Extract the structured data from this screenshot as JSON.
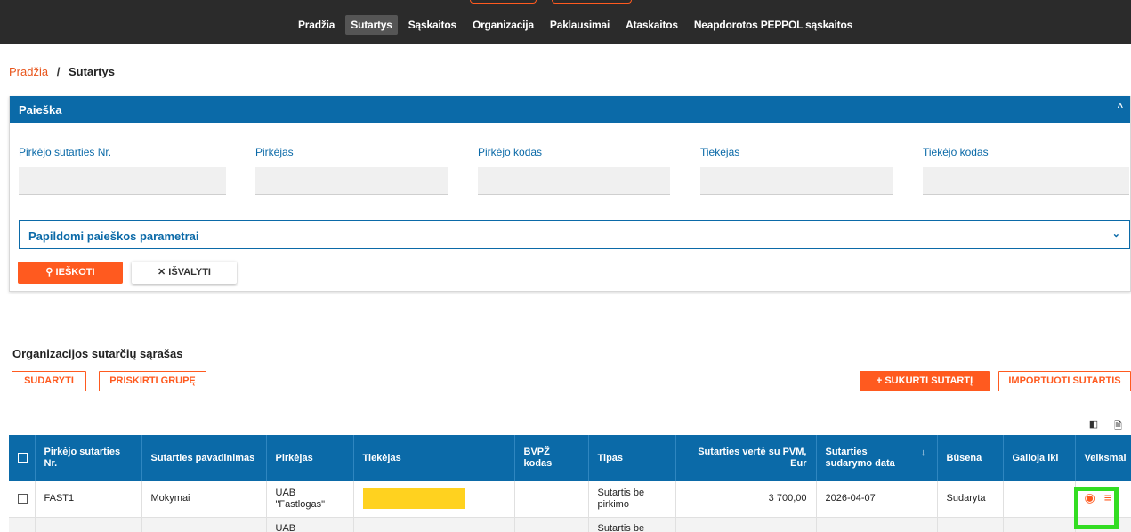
{
  "topnav": {
    "items": [
      {
        "label": "Pradžia",
        "active": false
      },
      {
        "label": "Sutartys",
        "active": true
      },
      {
        "label": "Sąskaitos",
        "active": false
      },
      {
        "label": "Organizacija",
        "active": false
      },
      {
        "label": "Paklausimai",
        "active": false
      },
      {
        "label": "Ataskaitos",
        "active": false
      },
      {
        "label": "Neapdorotos PEPPOL sąskaitos",
        "active": false
      }
    ]
  },
  "breadcrumb": {
    "home": "Pradžia",
    "separator": "/",
    "current": "Sutartys"
  },
  "search": {
    "title": "Paieška",
    "fields": [
      {
        "label": "Pirkėjo sutarties Nr.",
        "value": ""
      },
      {
        "label": "Pirkėjas",
        "value": ""
      },
      {
        "label": "Pirkėjo kodas",
        "value": ""
      },
      {
        "label": "Tiekėjas",
        "value": ""
      },
      {
        "label": "Tiekėjo kodas",
        "value": ""
      }
    ],
    "extra_params": "Papildomi paieškos parametrai",
    "search_button": "IEŠKOTI",
    "clear_button": "IŠVALYTI"
  },
  "list": {
    "title": "Organizacijos sutarčių sąrašas",
    "buttons": {
      "sudaryti": "SUDARYTI",
      "priskirti": "PRISKIRTI GRUPĘ",
      "sukurti": "SUKURTI SUTARTĮ",
      "importuoti": "IMPORTUOTI SUTARTIS"
    },
    "columns": [
      "Pirkėjo sutarties Nr.",
      "Sutarties pavadinimas",
      "Pirkėjas",
      "Tiekėjas",
      "BVPŽ kodas",
      "Tipas",
      "Sutarties vertė su PVM, Eur",
      "Sutarties sudarymo data",
      "Būsena",
      "Galioja iki",
      "Veiksmai"
    ],
    "sort_indicator": "↓",
    "rows": [
      {
        "nr": "FAST1",
        "name": "Mokymai",
        "buyer": "UAB \"Fastlogas\"",
        "supplier": "",
        "bvpz": "",
        "type": "Sutartis be pirkimo",
        "value": "3 700,00",
        "date": "2026-04-07",
        "status": "Sudaryta",
        "valid_until": ""
      },
      {
        "nr": "",
        "name": "",
        "buyer": "UAB",
        "supplier": "",
        "bvpz": "",
        "type": "Sutartis be",
        "value": "",
        "date": "",
        "status": "",
        "valid_until": ""
      }
    ]
  },
  "colors": {
    "nav_bg": "#2b2b2b",
    "primary_blue": "#0b6aa8",
    "accent_orange": "#ff5a1f",
    "highlight_yellow": "#ffd21f",
    "annotation_green": "#33dd22"
  },
  "icons": {
    "search": "search-icon",
    "clear": "close-icon",
    "add": "plus-icon",
    "view": "eye-icon",
    "row_menu": "menu-icon",
    "collapse": "chevron-up-icon",
    "expand": "chevron-down-icon"
  }
}
